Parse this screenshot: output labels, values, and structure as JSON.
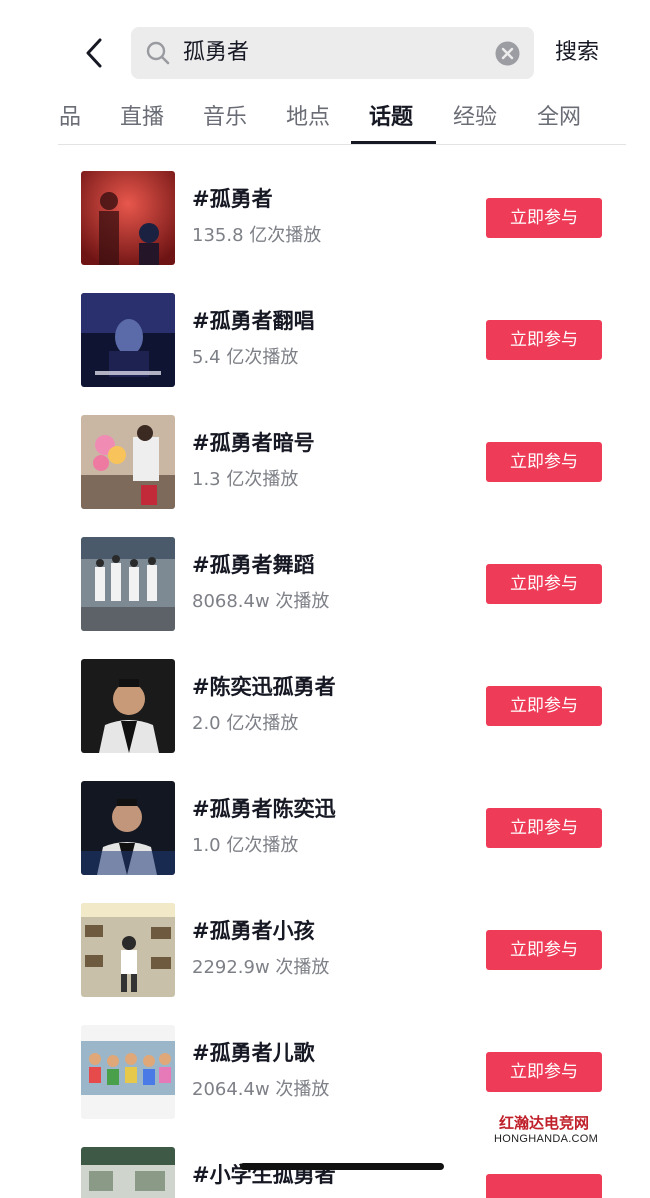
{
  "header": {
    "search_query": "孤勇者",
    "search_button": "搜索"
  },
  "tabs": [
    {
      "label": "品",
      "active": false
    },
    {
      "label": "直播",
      "active": false
    },
    {
      "label": "音乐",
      "active": false
    },
    {
      "label": "地点",
      "active": false
    },
    {
      "label": "话题",
      "active": true
    },
    {
      "label": "经验",
      "active": false
    },
    {
      "label": "全网",
      "active": false
    }
  ],
  "topics": [
    {
      "title": "#孤勇者",
      "plays": "135.8 亿次播放",
      "button": "立即参与"
    },
    {
      "title": "#孤勇者翻唱",
      "plays": "5.4 亿次播放",
      "button": "立即参与"
    },
    {
      "title": "#孤勇者暗号",
      "plays": "1.3 亿次播放",
      "button": "立即参与"
    },
    {
      "title": "#孤勇者舞蹈",
      "plays": "8068.4w 次播放",
      "button": "立即参与"
    },
    {
      "title": "#陈奕迅孤勇者",
      "plays": "2.0 亿次播放",
      "button": "立即参与"
    },
    {
      "title": "#孤勇者陈奕迅",
      "plays": "1.0 亿次播放",
      "button": "立即参与"
    },
    {
      "title": "#孤勇者小孩",
      "plays": "2292.9w 次播放",
      "button": "立即参与"
    },
    {
      "title": "#孤勇者儿歌",
      "plays": "2064.4w 次播放",
      "button": "立即参与"
    },
    {
      "title": "#小学生孤勇者",
      "plays": "",
      "button": ""
    }
  ],
  "watermark": {
    "brand": "红瀚达电竞网",
    "domain": "HONGHANDA.COM"
  },
  "colors": {
    "accent": "#ee3b58",
    "text": "#161823",
    "subtext": "#7e8087"
  }
}
